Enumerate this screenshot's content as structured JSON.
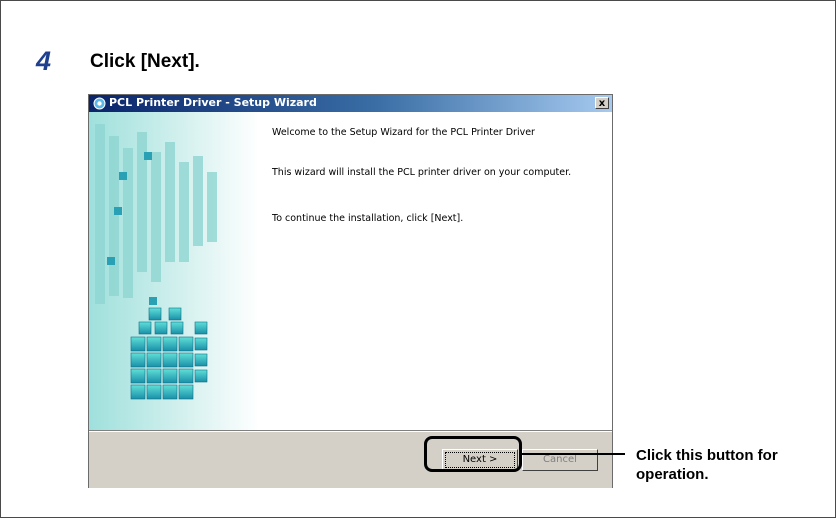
{
  "step": {
    "number": "4",
    "title": "Click [Next]."
  },
  "dialog": {
    "title": "PCL Printer Driver - Setup Wizard",
    "close_label": "x",
    "welcome": "Welcome to the Setup Wizard for the PCL Printer Driver",
    "description": "This wizard will install the PCL printer driver on your computer.",
    "instruction": "To continue the installation, click [Next].",
    "next_label": "Next >",
    "cancel_label": "Cancel"
  },
  "callout": {
    "text": "Click this button for operation."
  },
  "colors": {
    "step_number": "#1f3f8f",
    "titlebar_start": "#0a246a",
    "titlebar_end": "#a6caf0",
    "cube_teal": "#2bbfc0"
  }
}
